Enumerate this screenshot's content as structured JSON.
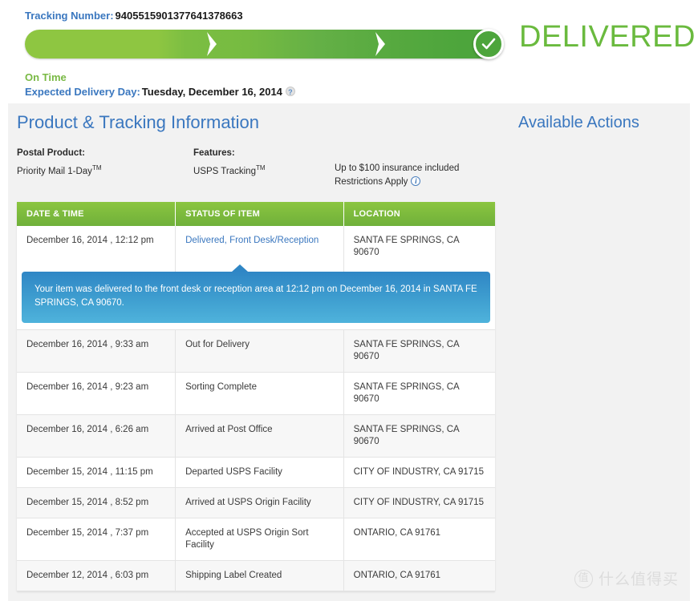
{
  "header": {
    "tracking_label": "Tracking Number:",
    "tracking_number": "9405515901377641378663",
    "status_word": "DELIVERED",
    "on_time": "On Time",
    "expected_label": "Expected Delivery Day:",
    "expected_value": "Tuesday, December 16, 2014",
    "help_icon_glyph": "?",
    "progress_steps": 3,
    "progress_complete": true
  },
  "panel": {
    "title": "Product & Tracking Information",
    "available_actions_title": "Available Actions",
    "postal_product_label": "Postal Product:",
    "postal_product_value": "Priority Mail 1-Day",
    "postal_product_tm": "TM",
    "features_label": "Features:",
    "features_value": "USPS Tracking",
    "features_tm": "TM",
    "insurance_note": "Up to $100 insurance included",
    "restrictions_note": "Restrictions Apply",
    "info_icon_glyph": "i"
  },
  "table": {
    "columns": [
      "DATE & TIME",
      "STATUS OF ITEM",
      "LOCATION"
    ],
    "rows": [
      {
        "date": "December 16, 2014 , 12:12 pm",
        "status": "Delivered, Front Desk/Reception",
        "location": "SANTA FE SPRINGS, CA 90670",
        "is_link": true
      },
      {
        "date": "December 16, 2014 , 9:33 am",
        "status": "Out for Delivery",
        "location": "SANTA FE SPRINGS, CA 90670",
        "is_link": false
      },
      {
        "date": "December 16, 2014 , 9:23 am",
        "status": "Sorting Complete",
        "location": "SANTA FE SPRINGS, CA 90670",
        "is_link": false
      },
      {
        "date": "December 16, 2014 , 6:26 am",
        "status": "Arrived at Post Office",
        "location": "SANTA FE SPRINGS, CA 90670",
        "is_link": false
      },
      {
        "date": "December 15, 2014 , 11:15 pm",
        "status": "Departed USPS Facility",
        "location": "CITY OF INDUSTRY, CA 91715",
        "is_link": false
      },
      {
        "date": "December 15, 2014 , 8:52 pm",
        "status": "Arrived at USPS Origin Facility",
        "location": "CITY OF INDUSTRY, CA 91715",
        "is_link": false
      },
      {
        "date": "December 15, 2014 , 7:37 pm",
        "status": "Accepted at USPS Origin Sort Facility",
        "location": "ONTARIO, CA 91761",
        "is_link": false
      },
      {
        "date": "December 12, 2014 , 6:03 pm",
        "status": "Shipping Label Created",
        "location": "ONTARIO, CA 91761",
        "is_link": false
      }
    ],
    "callout": "Your item was delivered to the front desk or reception area at 12:12 pm on December 16, 2014 in SANTA FE SPRINGS, CA 90670."
  },
  "watermark": {
    "badge": "值",
    "text": "什么值得买"
  },
  "colors": {
    "link_blue": "#3a77bf",
    "progress_green_light": "#8ec641",
    "progress_green_dark": "#4da53c",
    "delivered_green": "#6aba3e",
    "on_time_green": "#79b944",
    "header_green": "#7cbe40",
    "callout_blue": "#2f86c5",
    "panel_bg": "#f2f2f2"
  }
}
